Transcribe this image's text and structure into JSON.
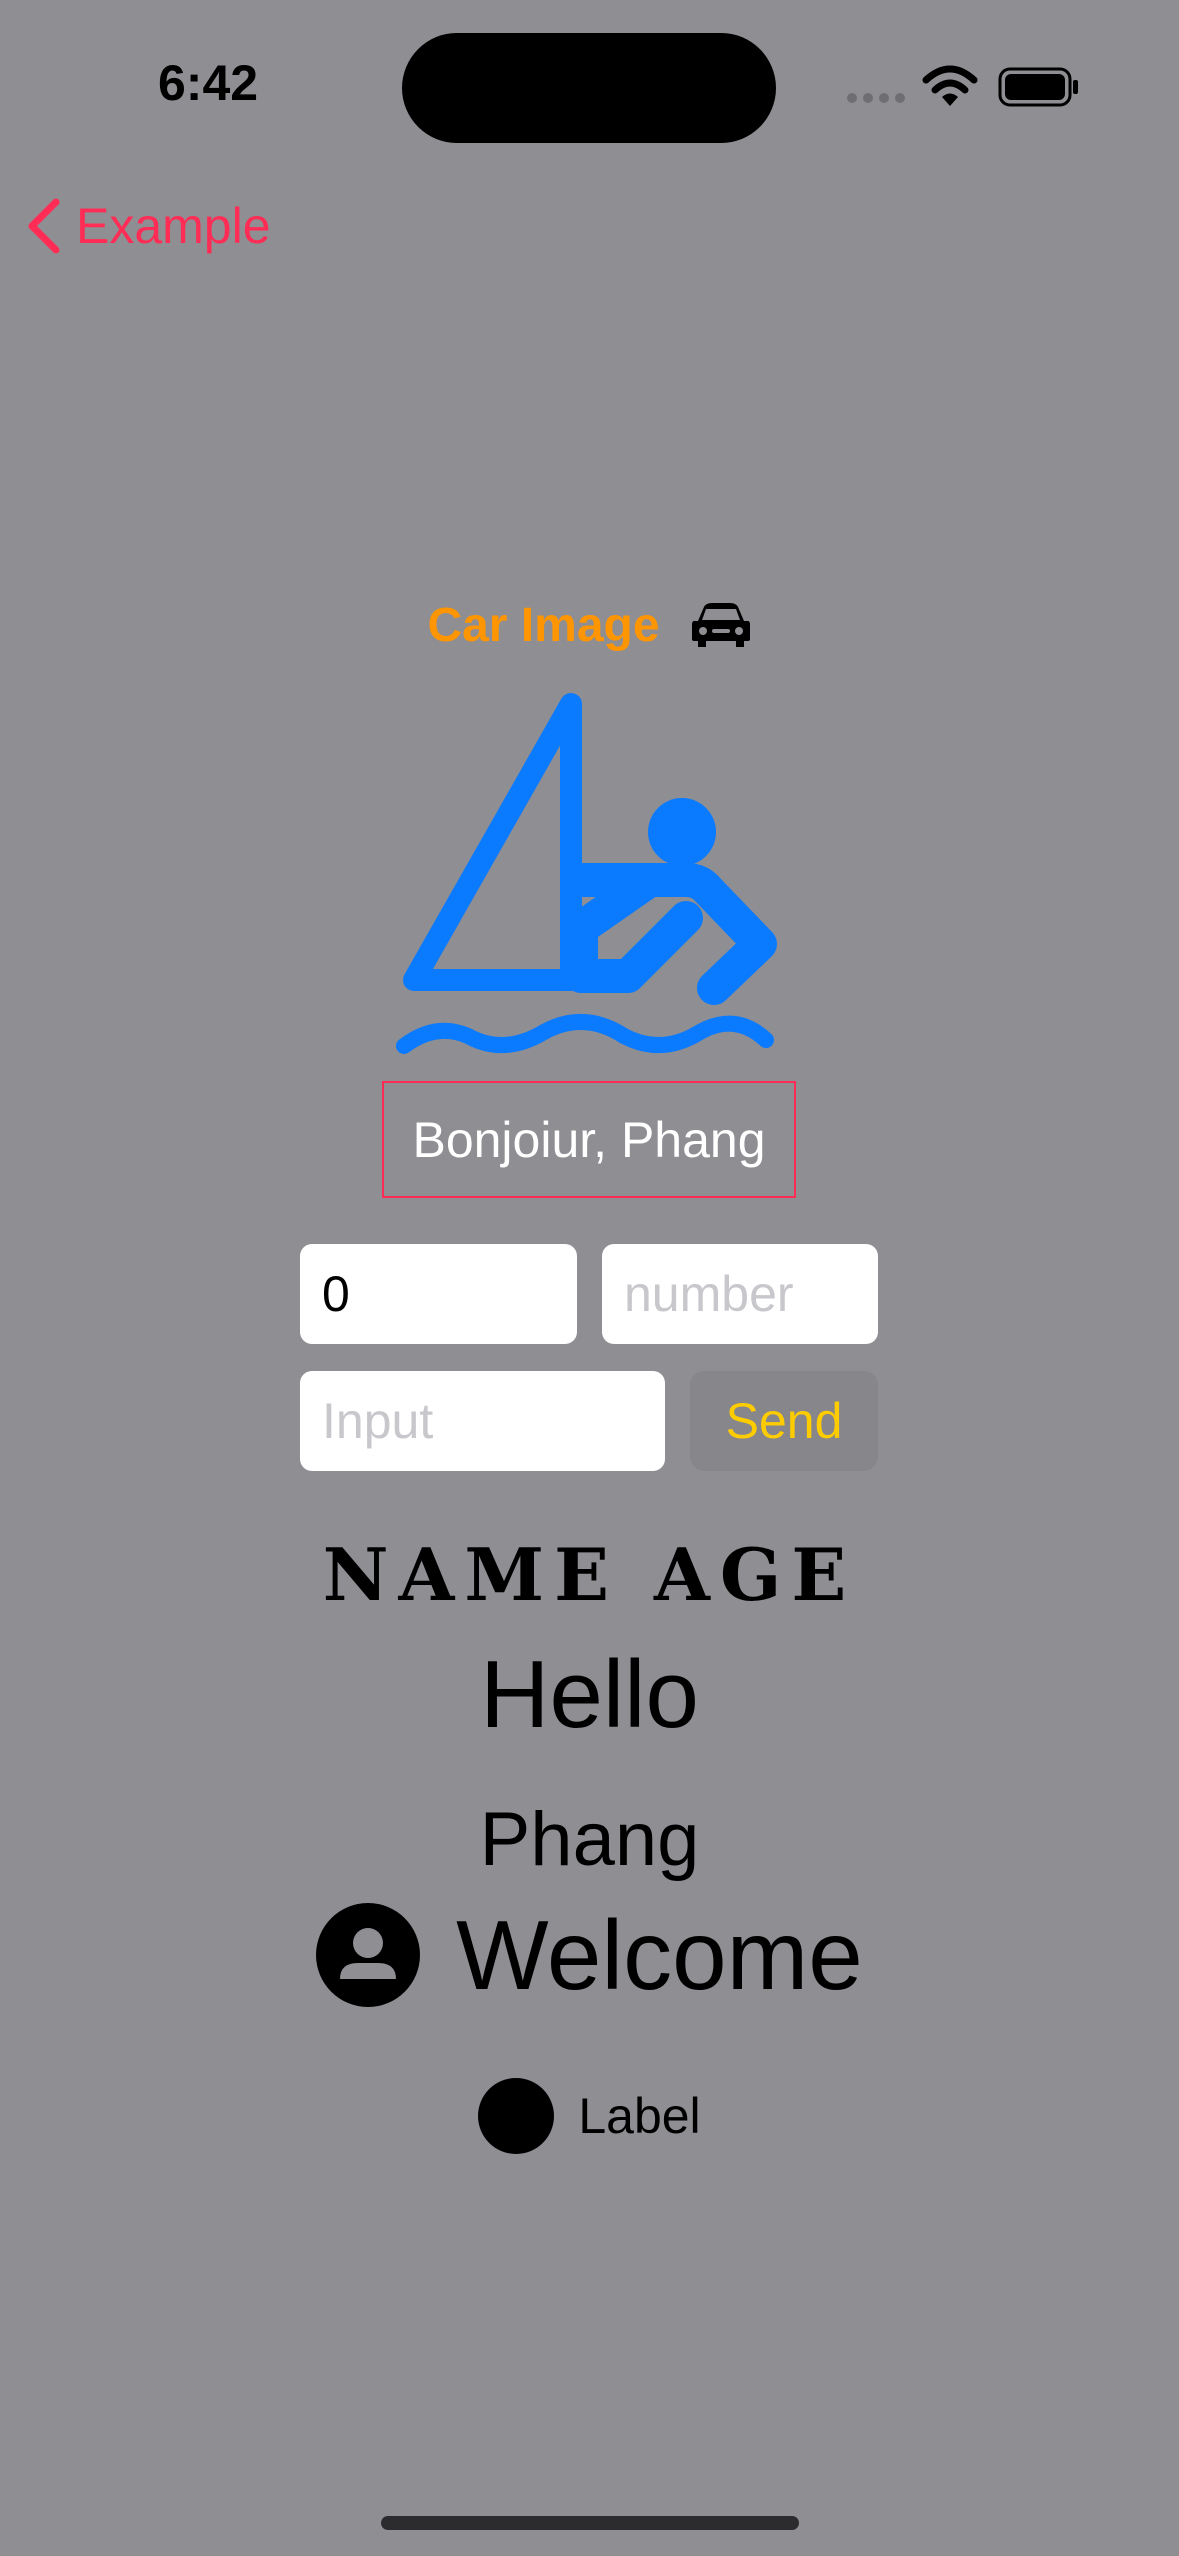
{
  "status_bar": {
    "time": "6:42",
    "icons": [
      "signal-icon",
      "wifi-icon",
      "battery-icon"
    ]
  },
  "nav": {
    "back_label": "Example"
  },
  "car_section": {
    "title": "Car Image",
    "icon": "car-icon",
    "image_icon": "person-sailing-icon"
  },
  "greeting": {
    "text": "Bonjoiur, Phang"
  },
  "form": {
    "count_value": "0",
    "number_placeholder": "number",
    "input_placeholder": "Input",
    "send_label": "Send"
  },
  "texts": {
    "name_age": "NAME AGE",
    "hello": "Hello",
    "phang": "Phang",
    "welcome": "Welcome",
    "welcome_icon": "person-circle-icon",
    "label": "Label"
  },
  "colors": {
    "background": "#8e8e93",
    "accent_pink": "#ff2d55",
    "accent_orange": "#ff9500",
    "accent_blue": "#0a7aff",
    "accent_yellow": "#ffcc00"
  }
}
